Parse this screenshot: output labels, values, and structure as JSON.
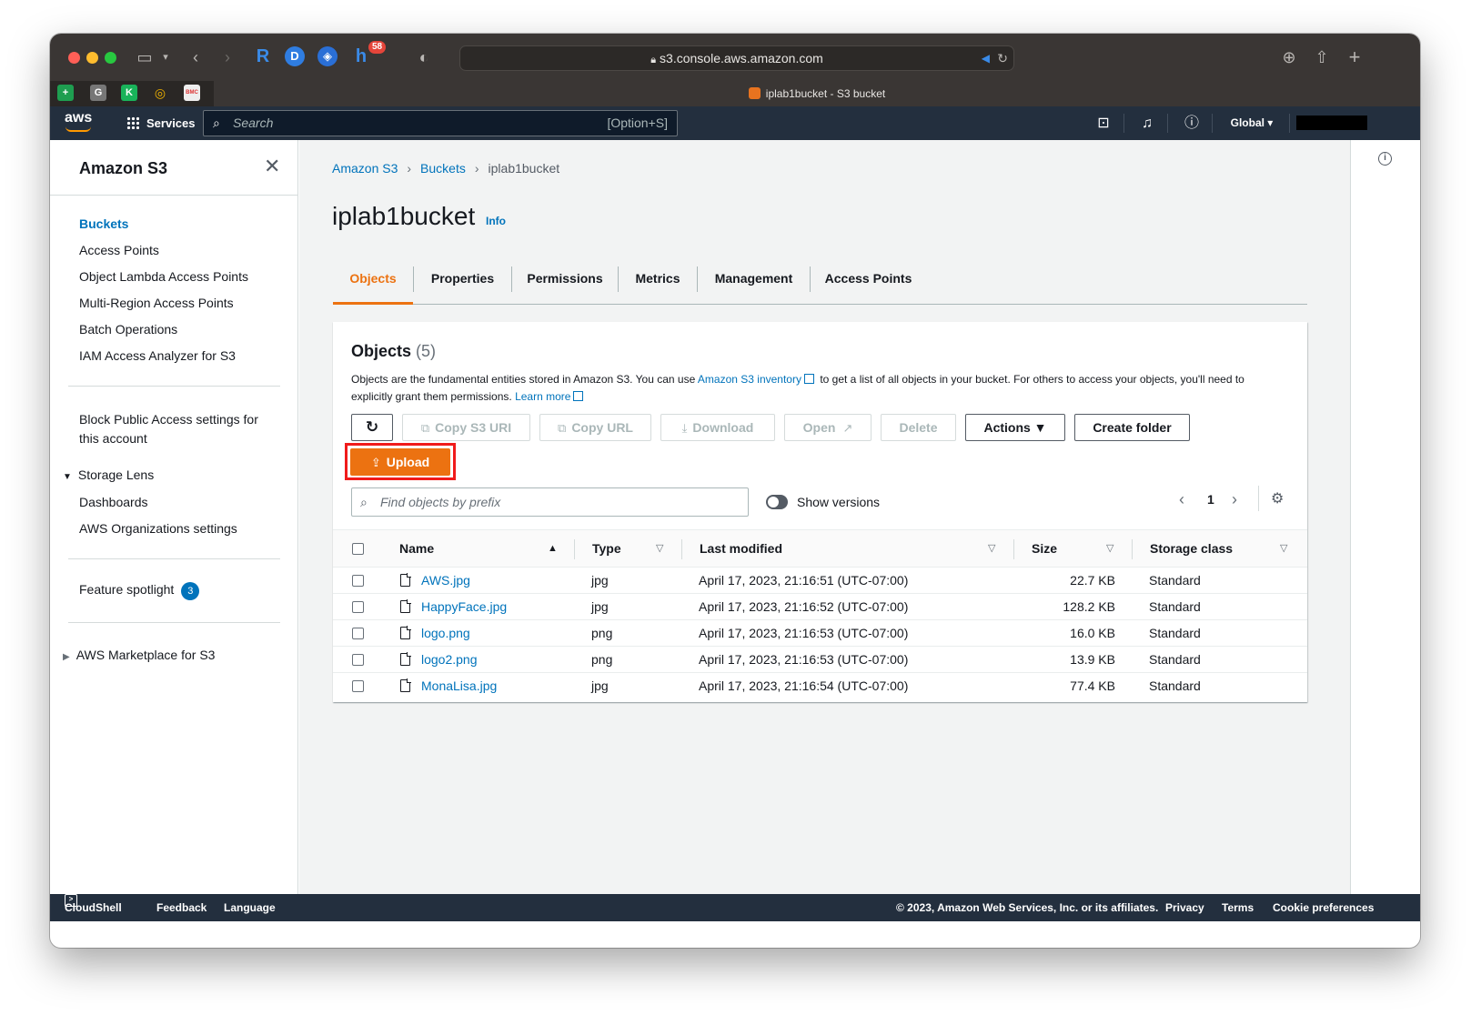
{
  "browser": {
    "url": "s3.console.aws.amazon.com",
    "tab_title": "iplab1bucket - S3 bucket",
    "extension_badge": "58",
    "pinned_tabs": [
      "+",
      "G",
      "K",
      "◎",
      "BMC"
    ],
    "icons": [
      "sidebar-icon",
      "back-icon",
      "forward-icon",
      "shield-icon",
      "download-icon",
      "share-icon",
      "new-tab-icon",
      "reload-icon",
      "speaker-icon",
      "lock-icon"
    ]
  },
  "aws_nav": {
    "logo": "aws",
    "services": "Services",
    "search_placeholder": "Search",
    "search_shortcut": "[Option+S]",
    "region": "Global ▾",
    "icons": [
      "cloudshell-icon",
      "bell-icon",
      "help-icon"
    ]
  },
  "sidebar": {
    "title": "Amazon S3",
    "items": [
      {
        "label": "Buckets"
      },
      {
        "label": "Access Points"
      },
      {
        "label": "Object Lambda Access Points"
      },
      {
        "label": "Multi-Region Access Points"
      },
      {
        "label": "Batch Operations"
      },
      {
        "label": "IAM Access Analyzer for S3"
      }
    ],
    "block_public_access": "Block Public Access settings for this account",
    "storage_lens": {
      "label": "Storage Lens",
      "items": [
        "Dashboards",
        "AWS Organizations settings"
      ]
    },
    "feature_spotlight": {
      "label": "Feature spotlight",
      "count": "3"
    },
    "marketplace": "AWS Marketplace for S3"
  },
  "breadcrumb": [
    "Amazon S3",
    "Buckets",
    "iplab1bucket"
  ],
  "page": {
    "title": "iplab1bucket",
    "info": "Info"
  },
  "tabs": [
    "Objects",
    "Properties",
    "Permissions",
    "Metrics",
    "Management",
    "Access Points"
  ],
  "objects_panel": {
    "title": "Objects",
    "count": "(5)",
    "desc_1": "Objects are the fundamental entities stored in Amazon S3. You can use",
    "desc_link": "Amazon S3 inventory",
    "desc_2": "to get a list of all objects in your bucket. For others to access your objects, you'll need to explicitly grant them permissions.",
    "learn_more": "Learn more",
    "buttons": {
      "copy_s3_uri": "Copy S3 URI",
      "copy_url": "Copy URL",
      "download": "Download",
      "open": "Open",
      "delete": "Delete",
      "actions": "Actions ▼",
      "create_folder": "Create folder",
      "upload": "Upload"
    },
    "filter_placeholder": "Find objects by prefix",
    "show_versions": "Show versions",
    "page": "1",
    "columns": [
      "Name",
      "Type",
      "Last modified",
      "Size",
      "Storage class"
    ],
    "rows": [
      {
        "name": "AWS.jpg",
        "type": "jpg",
        "modified": "April 17, 2023, 21:16:51 (UTC-07:00)",
        "size": "22.7 KB",
        "class": "Standard"
      },
      {
        "name": "HappyFace.jpg",
        "type": "jpg",
        "modified": "April 17, 2023, 21:16:52 (UTC-07:00)",
        "size": "128.2 KB",
        "class": "Standard"
      },
      {
        "name": "logo.png",
        "type": "png",
        "modified": "April 17, 2023, 21:16:53 (UTC-07:00)",
        "size": "16.0 KB",
        "class": "Standard"
      },
      {
        "name": "logo2.png",
        "type": "png",
        "modified": "April 17, 2023, 21:16:53 (UTC-07:00)",
        "size": "13.9 KB",
        "class": "Standard"
      },
      {
        "name": "MonaLisa.jpg",
        "type": "jpg",
        "modified": "April 17, 2023, 21:16:54 (UTC-07:00)",
        "size": "77.4 KB",
        "class": "Standard"
      }
    ]
  },
  "footer": {
    "cloudshell": "CloudShell",
    "feedback": "Feedback",
    "language": "Language",
    "copyright": "© 2023, Amazon Web Services, Inc. or its affiliates.",
    "privacy": "Privacy",
    "terms": "Terms",
    "cookies": "Cookie preferences"
  },
  "colors": {
    "accent": "#ec7211",
    "link": "#0073bb",
    "nav": "#232f3e",
    "highlight": "#f01b1b"
  }
}
